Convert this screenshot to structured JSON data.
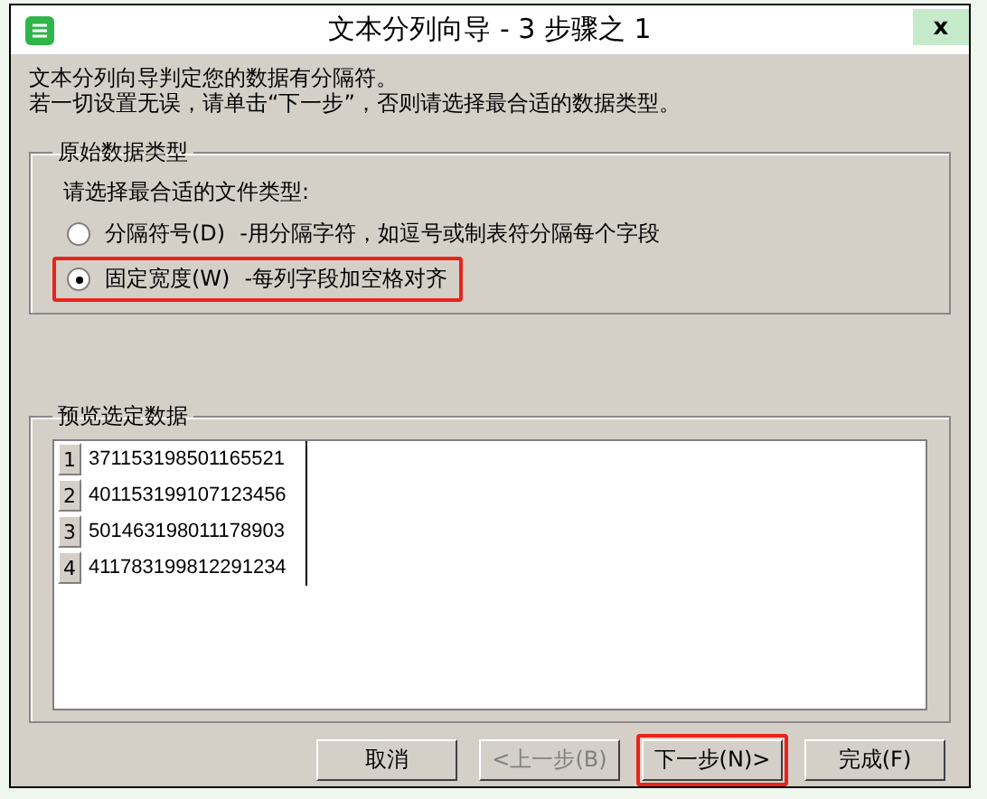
{
  "window": {
    "title": "文本分列向导 - 3 步骤之 1",
    "close": "x"
  },
  "intro": [
    "文本分列向导判定您的数据有分隔符。",
    "若一切设置无误，请单击“下一步”，否则请选择最合适的数据类型。"
  ],
  "data_type": {
    "title": "原始数据类型",
    "prompt": "请选择最合适的文件类型:",
    "options": [
      {
        "label": "分隔符号(D)",
        "description": "-用分隔字符，如逗号或制表符分隔每个字段",
        "selected": false,
        "highlighted": false
      },
      {
        "label": "固定宽度(W)",
        "description": "-每列字段加空格对齐",
        "selected": true,
        "highlighted": true
      }
    ]
  },
  "preview": {
    "title": "预览选定数据",
    "rows": [
      {
        "number": "1",
        "value": "371153198501165521"
      },
      {
        "number": "2",
        "value": "401153199107123456"
      },
      {
        "number": "3",
        "value": "501463198011178903"
      },
      {
        "number": "4",
        "value": "411783199812291234"
      }
    ]
  },
  "buttons": [
    {
      "label": "取消",
      "disabled": false,
      "highlighted": false
    },
    {
      "label": "<上一步(B)",
      "disabled": true,
      "highlighted": false
    },
    {
      "label": "下一步(N)>",
      "disabled": false,
      "highlighted": true
    },
    {
      "label": "完成(F)",
      "disabled": false,
      "highlighted": false
    }
  ]
}
